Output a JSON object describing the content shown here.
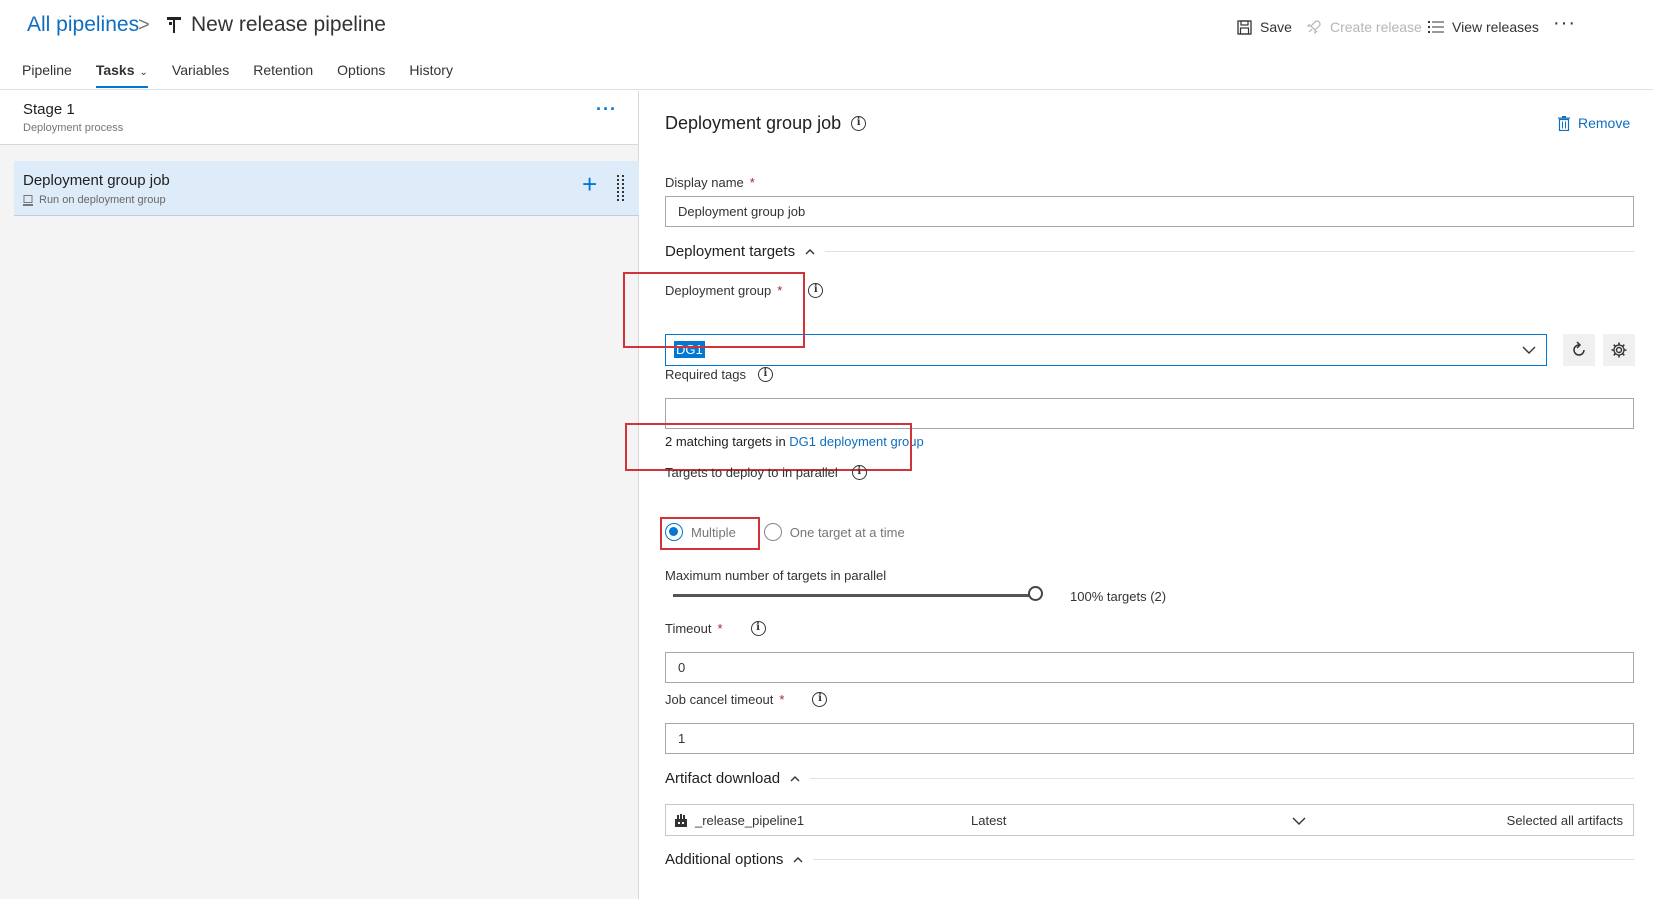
{
  "header": {
    "breadcrumb_root": "All pipelines",
    "breadcrumb_sep": ">",
    "title": "New release pipeline",
    "actions": {
      "save": "Save",
      "create_release": "Create release",
      "view_releases": "View releases",
      "more": "···"
    }
  },
  "tabs": [
    {
      "label": "Pipeline"
    },
    {
      "label": "Tasks",
      "active": true
    },
    {
      "label": "Variables"
    },
    {
      "label": "Retention"
    },
    {
      "label": "Options"
    },
    {
      "label": "History"
    }
  ],
  "stage": {
    "name": "Stage 1",
    "subtitle": "Deployment process",
    "more": "···"
  },
  "job": {
    "name": "Deployment group job",
    "subtitle": "Run on deployment group"
  },
  "panel": {
    "title": "Deployment group job",
    "remove": "Remove",
    "display_name_label": "Display name",
    "display_name_value": "Deployment group job",
    "deployment_targets_section": "Deployment targets",
    "deployment_group_label": "Deployment group",
    "deployment_group_value": "DG1",
    "required_tags_label": "Required tags",
    "required_tags_value": "",
    "matching_prefix": "2 matching targets in ",
    "matching_link": "DG1 deployment group",
    "parallel_label": "Targets to deploy to in parallel",
    "radio_multiple": "Multiple",
    "radio_one": "One target at a time",
    "max_parallel_label": "Maximum number of targets in parallel",
    "max_parallel_value": "100% targets (2)",
    "max_parallel_fraction": 1.0,
    "timeout_label": "Timeout",
    "timeout_value": "0",
    "job_cancel_label": "Job cancel timeout",
    "job_cancel_value": "1",
    "artifact_section": "Artifact download",
    "artifact_name": "_release_pipeline1",
    "artifact_version": "Latest",
    "artifact_selection": "Selected all artifacts",
    "additional_section": "Additional options",
    "required_mark": "*"
  },
  "colors": {
    "accent": "#0078d4",
    "link": "#106ebe",
    "highlight_box": "#d13438",
    "selected_row": "#deecf9"
  }
}
